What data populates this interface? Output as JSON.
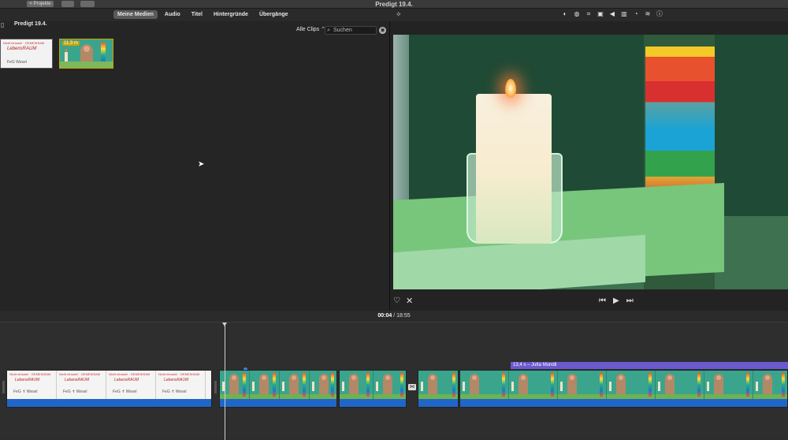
{
  "window": {
    "title": "Predigt 19.4.",
    "back_label": "< Projekte",
    "toolbar_btn2": "",
    "toolbar_btn3": ""
  },
  "media_tabs": [
    "Meine Medien",
    "Audio",
    "Titel",
    "Hintergründe",
    "Übergänge"
  ],
  "active_tab": "Meine Medien",
  "browser": {
    "event_title": "Predigt 19.4.",
    "filter_label": "Alle Clips",
    "search_placeholder": "Suchen",
    "clips": [
      {
        "type": "logo",
        "line1": "Nicht einsam! · GEMEINSAM",
        "main": "LebensRAUM",
        "feg": "FeG Wesel"
      },
      {
        "type": "scene",
        "duration": "11,3 m"
      }
    ]
  },
  "viewer": {
    "tools": [
      "color-balance-icon",
      "color-correction-icon",
      "crop-icon",
      "stabilization-icon",
      "volume-icon",
      "equalizer-icon",
      "speed-icon",
      "noise-reduction-icon",
      "info-icon"
    ]
  },
  "timecode": {
    "current": "00:04",
    "separator": "/",
    "total": "18:55"
  },
  "timeline": {
    "title_clip_label": "13,4 s – Jutta Mundil",
    "logo_frame_lines": {
      "line1": "Nicht einsam! · GEMEINSAM",
      "main": "LebensRAUM",
      "feg": "FeG ✝ Wesel"
    }
  }
}
